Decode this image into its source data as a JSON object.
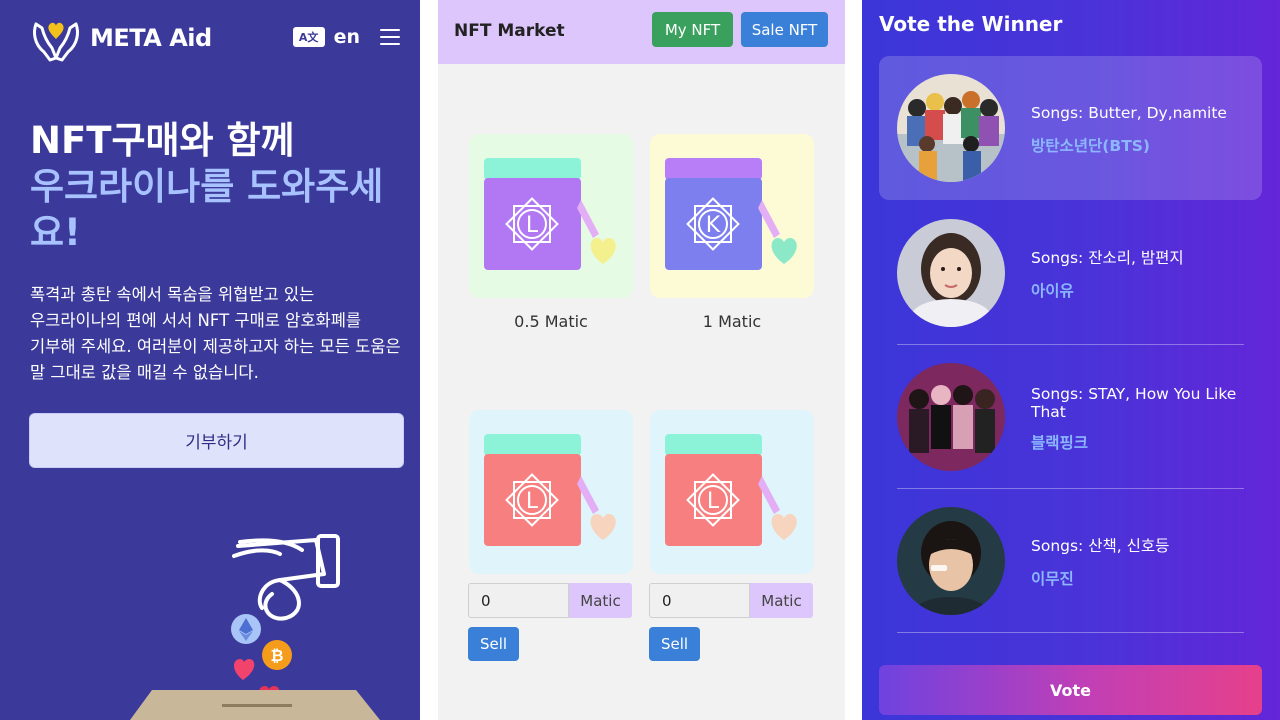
{
  "aid_panel": {
    "logo_text": "META Aid",
    "lang_icon_label": "A文",
    "lang_code": "en",
    "hero_line1": "NFT구매와 함께",
    "hero_line2": "우크라이나를 도와주세요!",
    "description": "폭격과 총탄 속에서 목숨을 위협받고 있는 우크라이나의 편에 서서 NFT 구매로 암호화폐를 기부해 주세요. 여러분이 제공하고자 하는 모든 도움은 말 그대로 값을 매길 수 없습니다.",
    "donate_label": "기부하기",
    "icons": [
      "hands-heart-icon",
      "translate-icon",
      "menu-icon",
      "hand-coin-illustration",
      "ethereum-icon",
      "bitcoin-icon",
      "heart-icon"
    ],
    "colors": {
      "background": "#3b3a9a",
      "highlight": "#a8c1ff",
      "button": "#dfe2fb"
    }
  },
  "market_panel": {
    "title": "NFT Market",
    "my_nft_label": "My NFT",
    "sale_nft_label": "Sale NFT",
    "market_items": [
      {
        "letter": "L",
        "price": "0.5 Matic",
        "bg": "#e6fbe4",
        "lid": "#8df3d8",
        "body": "#b278f4",
        "heart": "#f4f08e"
      },
      {
        "letter": "K",
        "price": "1 Matic",
        "bg": "#fdfbd6",
        "lid": "#b87ef7",
        "body": "#7d7fee",
        "heart": "#8ce9c8"
      }
    ],
    "my_items": [
      {
        "letter": "L",
        "input_value": "0",
        "unit": "Matic",
        "sell_label": "Sell",
        "bg": "#dff5fb",
        "lid": "#8df3d8",
        "body": "#f77f7f",
        "heart": "#f7d4bd"
      },
      {
        "letter": "L",
        "input_value": "0",
        "unit": "Matic",
        "sell_label": "Sell",
        "bg": "#dff5fb",
        "lid": "#8df3d8",
        "body": "#f77f7f",
        "heart": "#f7d4bd"
      }
    ],
    "colors": {
      "header": "#dcc6fb",
      "green_button": "#3aa05d",
      "blue_button": "#3a80d8"
    }
  },
  "vote_panel": {
    "title": "Vote the Winner",
    "candidates": [
      {
        "songs": "Songs: Butter, Dy,namite",
        "artist": "방탄소년단(BTS)",
        "selected": true
      },
      {
        "songs": "Songs: 잔소리, 밤편지",
        "artist": "아이유",
        "selected": false
      },
      {
        "songs": "Songs: STAY, How You Like That",
        "artist": "블랙핑크",
        "selected": false
      },
      {
        "songs": "Songs: 산책, 신호등",
        "artist": "이무진",
        "selected": false
      }
    ],
    "vote_label": "Vote",
    "colors": {
      "gradient_start": "#3b36d8",
      "gradient_end": "#6326d8",
      "artist": "#8cb7ff",
      "vote_start": "#6f42e0",
      "vote_end": "#e6408a"
    }
  }
}
